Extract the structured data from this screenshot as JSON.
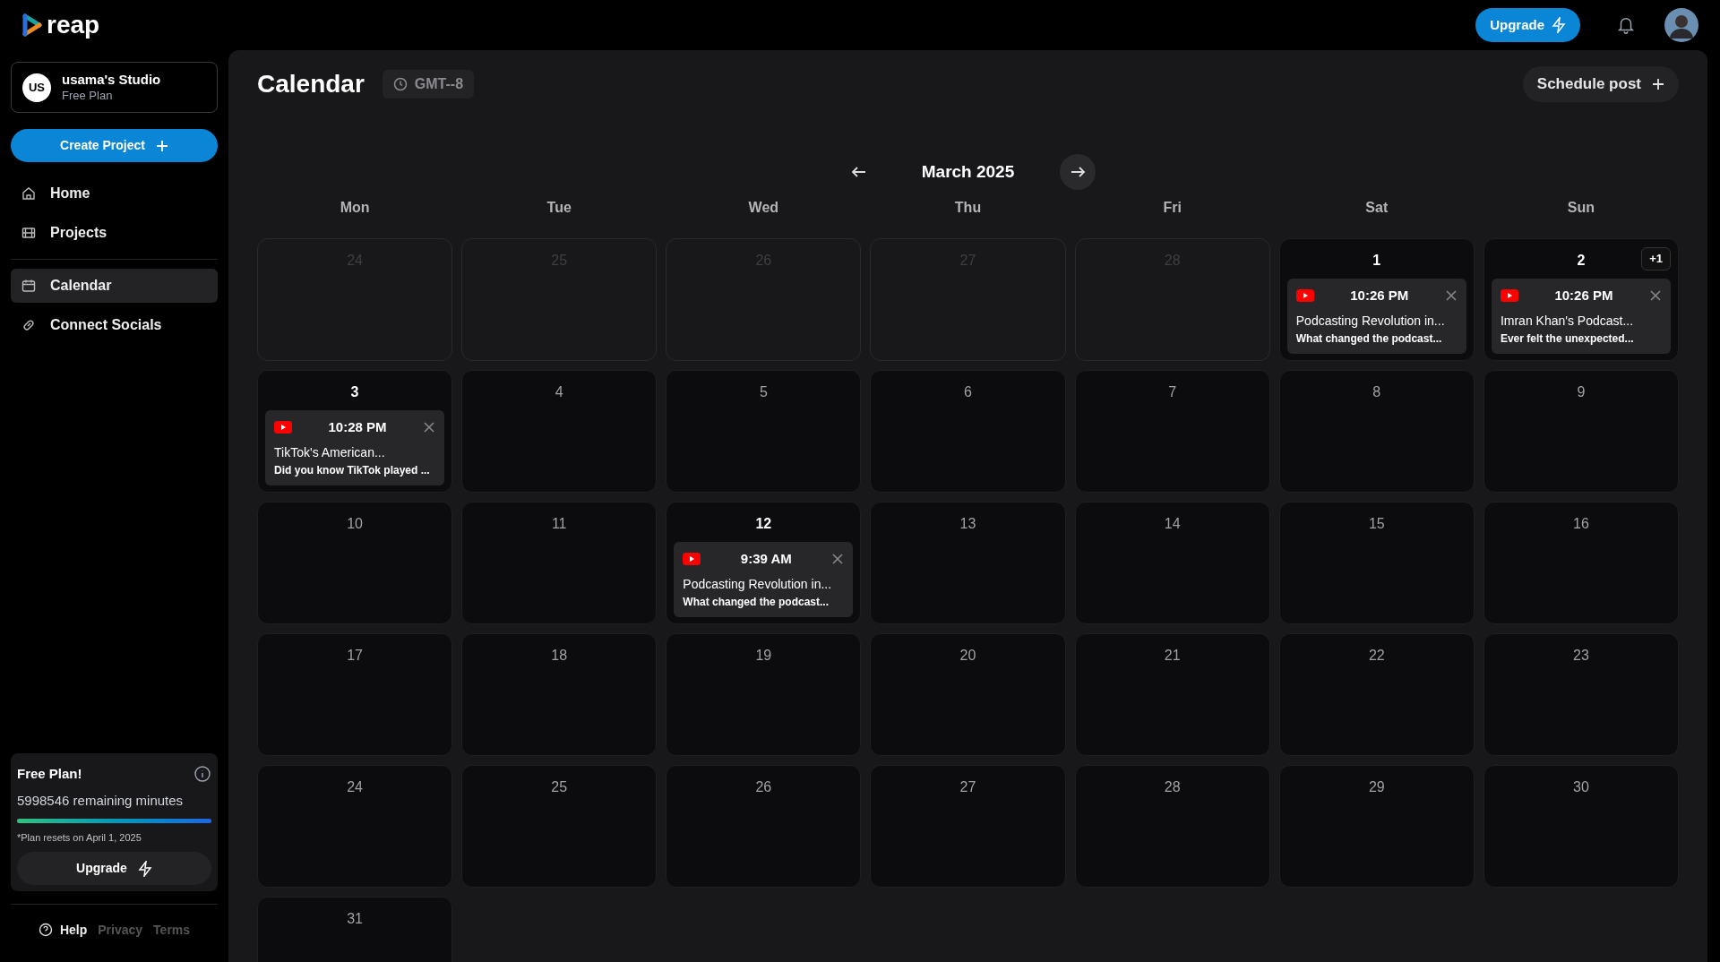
{
  "brand": "reap",
  "header": {
    "upgrade": "Upgrade"
  },
  "workspace": {
    "initials": "US",
    "name": "usama's Studio",
    "plan": "Free Plan"
  },
  "create_button": "Create Project",
  "nav": [
    {
      "items": [
        {
          "label": "Home",
          "selected": false
        },
        {
          "label": "Projects",
          "selected": false
        }
      ]
    },
    {
      "items": [
        {
          "label": "Calendar",
          "selected": true
        },
        {
          "label": "Connect Socials",
          "selected": false
        }
      ]
    }
  ],
  "plan_card": {
    "title": "Free Plan!",
    "remaining": "5998546 remaining minutes",
    "level": 1,
    "note": "*Plan resets on April 1, 2025",
    "button": "Upgrade"
  },
  "footer": [
    {
      "label": "Help",
      "kind": "help"
    },
    {
      "label": "Privacy",
      "kind": "link"
    },
    {
      "label": "Terms",
      "kind": "link"
    }
  ],
  "page": {
    "title": "Calendar",
    "timezone": "GMT--8",
    "schedule_button": "Schedule post"
  },
  "month": "March 2025",
  "weekdays": [
    "Mon",
    "Tue",
    "Wed",
    "Thu",
    "Fri",
    "Sat",
    "Sun"
  ],
  "days": [
    {
      "day": "24",
      "outside": true
    },
    {
      "day": "25",
      "outside": true
    },
    {
      "day": "26",
      "outside": true
    },
    {
      "day": "27",
      "outside": true
    },
    {
      "day": "28",
      "outside": true
    },
    {
      "day": "1",
      "events": [
        {
          "time": "10:26 PM",
          "title": "Podcasting Revolution in...",
          "subtitle": "What changed the podcast..."
        }
      ]
    },
    {
      "day": "2",
      "more": "+1",
      "events": [
        {
          "time": "10:26 PM",
          "title": "Imran Khan's Podcast...",
          "subtitle": "Ever felt the unexpected..."
        }
      ]
    },
    {
      "day": "3",
      "events": [
        {
          "time": "10:28 PM",
          "title": "TikTok's American...",
          "subtitle": "Did you know TikTok played ..."
        }
      ]
    },
    {
      "day": "4"
    },
    {
      "day": "5"
    },
    {
      "day": "6"
    },
    {
      "day": "7"
    },
    {
      "day": "8"
    },
    {
      "day": "9"
    },
    {
      "day": "10"
    },
    {
      "day": "11"
    },
    {
      "day": "12",
      "events": [
        {
          "time": "9:39 AM",
          "title": "Podcasting Revolution in...",
          "subtitle": "What changed the podcast..."
        }
      ]
    },
    {
      "day": "13"
    },
    {
      "day": "14"
    },
    {
      "day": "15"
    },
    {
      "day": "16"
    },
    {
      "day": "17"
    },
    {
      "day": "18"
    },
    {
      "day": "19"
    },
    {
      "day": "20"
    },
    {
      "day": "21"
    },
    {
      "day": "22"
    },
    {
      "day": "23"
    },
    {
      "day": "24"
    },
    {
      "day": "25"
    },
    {
      "day": "26"
    },
    {
      "day": "27"
    },
    {
      "day": "28"
    },
    {
      "day": "29"
    },
    {
      "day": "30"
    },
    {
      "day": "31"
    }
  ]
}
